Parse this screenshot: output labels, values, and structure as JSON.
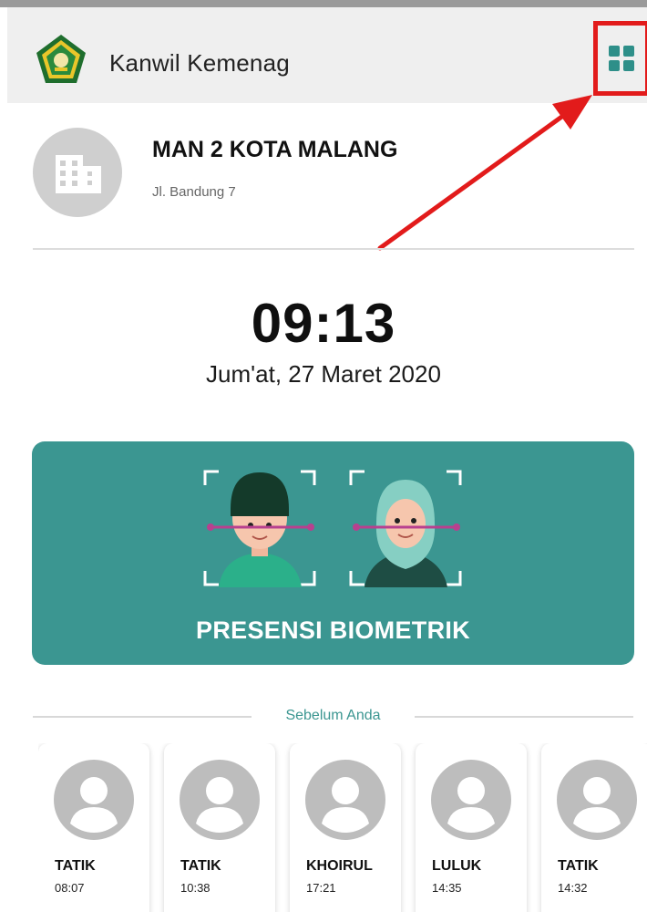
{
  "header": {
    "title": "Kanwil Kemenag",
    "menu_icon": "grid-icon"
  },
  "school": {
    "name": "MAN 2 KOTA MALANG",
    "address": "Jl. Bandung 7"
  },
  "clock": {
    "time": "09:13",
    "date": "Jum'at, 27 Maret 2020"
  },
  "biometric": {
    "label": "PRESENSI BIOMETRIK"
  },
  "previous": {
    "label": "Sebelum Anda",
    "users": [
      {
        "name": "TATIK",
        "time": "08:07"
      },
      {
        "name": "TATIK",
        "time": "10:38"
      },
      {
        "name": "KHOIRUL",
        "time": "17:21"
      },
      {
        "name": "LULUK",
        "time": "14:35"
      },
      {
        "name": "TATIK",
        "time": "14:32"
      }
    ]
  },
  "colors": {
    "accent": "#3b9691",
    "highlight": "#e21b1b",
    "appbar": "#efefef"
  }
}
